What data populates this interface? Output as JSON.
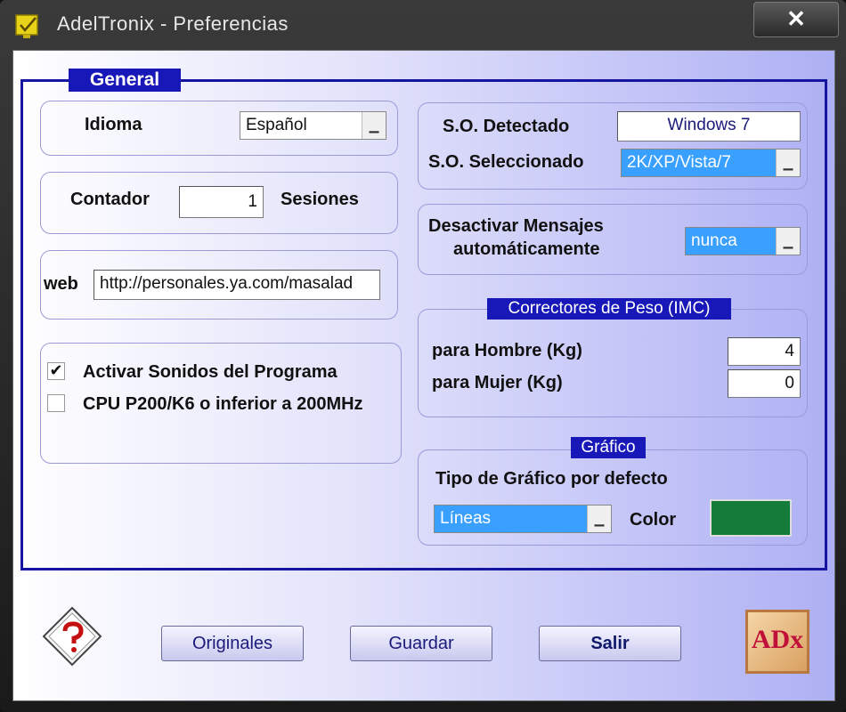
{
  "window": {
    "title": "AdelTronix  -  Preferencias",
    "close_label": "✕"
  },
  "general": {
    "title": "General"
  },
  "idioma": {
    "label": "Idioma",
    "value": "Español"
  },
  "contador": {
    "label": "Contador",
    "value": "1",
    "suffix": "Sesiones"
  },
  "web": {
    "label": "web",
    "value": "http://personales.ya.com/masalad"
  },
  "options": {
    "sonidos": {
      "label": "Activar Sonidos del Programa",
      "checked": true,
      "mark": "✔"
    },
    "cpu": {
      "label": "CPU P200/K6 o inferior a 200MHz",
      "checked": false,
      "mark": ""
    }
  },
  "so": {
    "detectado_label": "S.O. Detectado",
    "detectado_value": "Windows 7",
    "seleccionado_label": "S.O. Seleccionado",
    "seleccionado_value": "2K/XP/Vista/7"
  },
  "mensajes": {
    "label_line1": "Desactivar Mensajes",
    "label_line2": "automáticamente",
    "value": "nunca"
  },
  "correctores": {
    "title": "Correctores de Peso (IMC)",
    "hombre_label": "para Hombre (Kg)",
    "hombre_value": "4",
    "mujer_label": "para Mujer (Kg)",
    "mujer_value": "0"
  },
  "grafico": {
    "title": "Gráfico",
    "tipo_label": "Tipo de Gráfico por defecto",
    "tipo_value": "Líneas",
    "color_label": "Color",
    "color_value": "#137c3a"
  },
  "buttons": {
    "originales": "Originales",
    "guardar": "Guardar",
    "salir": "Salir"
  },
  "logo": {
    "text": "ADx"
  },
  "icons": {
    "app": "note-check-icon",
    "help": "help-key-icon",
    "dropdown": "▁"
  },
  "colors": {
    "frame": "#1515a0",
    "label_bg": "#1818b8",
    "combo_selected": "#3aa0ff"
  }
}
